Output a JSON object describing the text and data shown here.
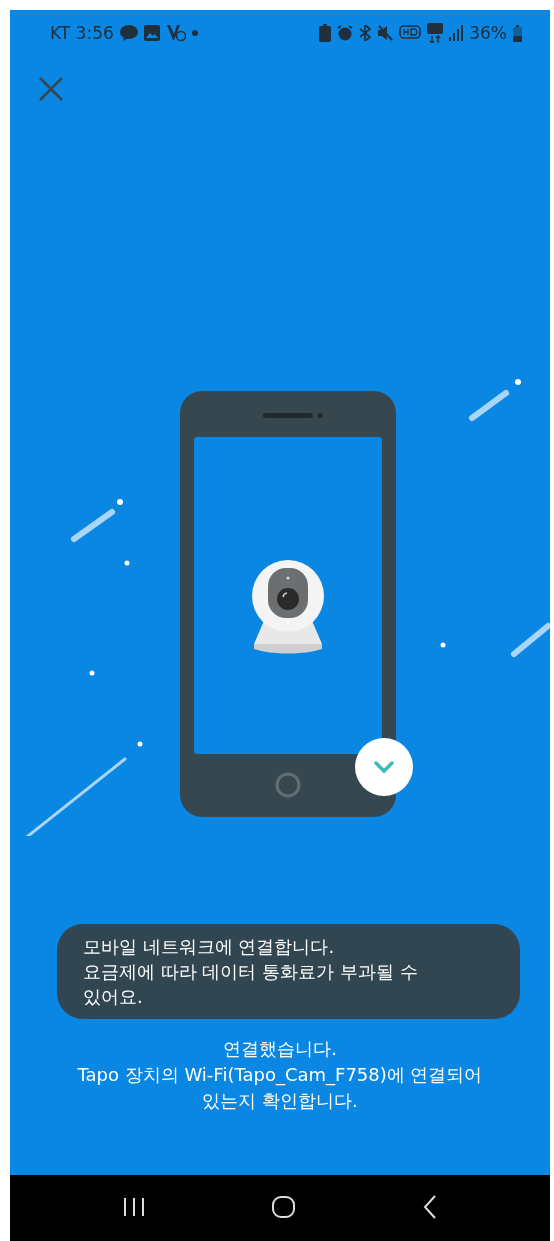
{
  "status_bar": {
    "carrier_time": "KT 3:56",
    "battery": "36%"
  },
  "message": {
    "title": "연결했습니다.",
    "body": "Tapo 장치의 Wi-Fi(Tapo_Cam_F758)에 연결되어 있는지 확인합니다."
  },
  "toast": {
    "lines": [
      "모바일 네트워크에 연결합니다.",
      "요금제에 따라 데이터 통화료가 부과될 수 있어요."
    ]
  }
}
